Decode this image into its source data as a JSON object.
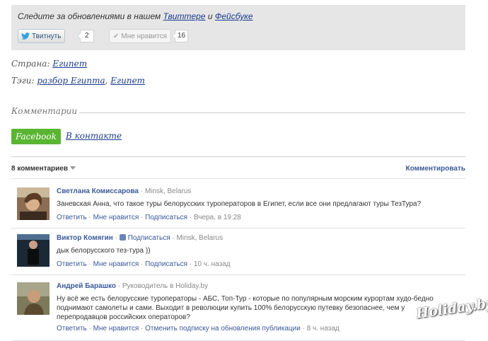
{
  "follow": {
    "text_prefix": "Следите за обновлениями в нашем ",
    "twitter_link": "Твиттере",
    "conjunction": " и ",
    "facebook_link": "Фейсбуке",
    "tweet_label": "Твитнуть",
    "tweet_count": "2",
    "like_label": "Мне нравится",
    "like_count": "16"
  },
  "meta": {
    "country_label": "Страна:",
    "country_value": "Египет",
    "tags_label": "Тэги:",
    "tags": [
      "разбор Египта",
      "Египет"
    ],
    "tag_separator": ","
  },
  "comments_section": {
    "title": "Комментарии",
    "tabs": [
      "Facebook",
      "В контакте"
    ],
    "count_label": "8 комментариев",
    "comment_button": "Комментировать"
  },
  "comments": [
    {
      "name": "Светлана Комиссарова",
      "subtitle_sep": " · ",
      "location": "Minsk, Belarus",
      "text": "Заневская Анна, что такое туры белорусских туроператоров в Египет, если все они предлагают туры ТезТура?",
      "actions": [
        "Ответить",
        "Мне нравится",
        "Подписаться"
      ],
      "time": "Вчера, в 19:28"
    },
    {
      "name": "Виктор Комягин",
      "subscribe": "Подписаться",
      "location": "Minsk, Belarus",
      "text": "дык белорусского тез-тура ))",
      "actions": [
        "Ответить",
        "Мне нравится",
        "Подписаться"
      ],
      "time": "10 ч. назад"
    },
    {
      "name": "Андрей Барашко",
      "role": "Руководитель в Holiday.by",
      "text_lines": [
        "Ну всё же есть белорусские туроператоры - АБС, Топ-Тур - которые по популярным морским курортам худо-бедно",
        "поднимают самолеты и сами. Выходит в революции купить 100% белорусскую путевку безопаснее, чем у",
        "перепродавцов российских операторов?"
      ],
      "actions": [
        "Ответить",
        "Мне нравится",
        "Отменить подписку на обновления публикации"
      ],
      "time": "8 ч. назад"
    }
  ],
  "watermark": "Holiday.by",
  "colors": {
    "link": "#1a3a8c",
    "fb_link": "#3b5998",
    "facebook_tab": "#5ab533",
    "follow_box_bg": "#e6e6e6"
  }
}
